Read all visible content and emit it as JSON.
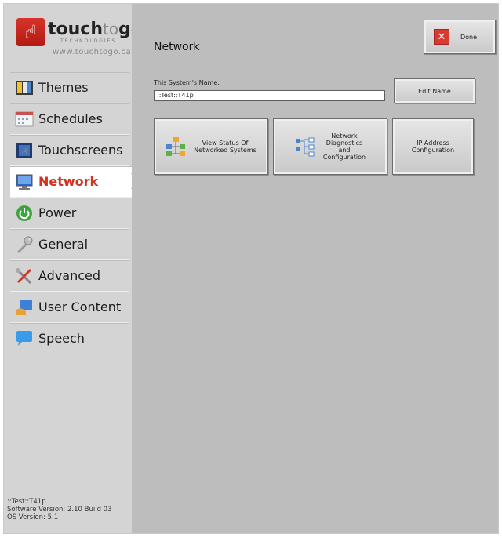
{
  "logo": {
    "brand_main": "touch",
    "brand_to": "to",
    "brand_go": "go",
    "brand_sub": "TECHNOLOGIES",
    "url": "www.touchtogo.ca"
  },
  "sidebar": {
    "items": [
      {
        "label": "Themes",
        "icon": "themes-icon",
        "active": false
      },
      {
        "label": "Schedules",
        "icon": "calendar-icon",
        "active": false
      },
      {
        "label": "Touchscreens",
        "icon": "touchscreen-icon",
        "active": false
      },
      {
        "label": "Network",
        "icon": "monitor-icon",
        "active": true
      },
      {
        "label": "Power",
        "icon": "power-icon",
        "active": false
      },
      {
        "label": "General",
        "icon": "wrench-icon",
        "active": false
      },
      {
        "label": "Advanced",
        "icon": "tools-icon",
        "active": false
      },
      {
        "label": "User Content",
        "icon": "user-content-icon",
        "active": false
      },
      {
        "label": "Speech",
        "icon": "speech-bubble-icon",
        "active": false
      }
    ]
  },
  "footer": {
    "system": "::Test::T41p",
    "software_version": "Software Version: 2.10 Build 03",
    "os_version": "OS Version: 5.1"
  },
  "main": {
    "title": "Network",
    "done_label": "Done",
    "name_label": "This System's Name:",
    "name_value": "::Test::T41p",
    "edit_name_label": "Edit Name",
    "buttons": [
      {
        "label": "View Status Of\nNetworked Systems",
        "icon": "network-status-icon"
      },
      {
        "label": "Network\nDiagnostics\nand\nConfiguration",
        "icon": "diagnostics-icon"
      },
      {
        "label": "IP Address\nConfiguration",
        "icon": ""
      }
    ]
  },
  "colors": {
    "accent_red": "#d2321f",
    "background": "#bdbdbd",
    "sidebar": "#d4d4d4"
  }
}
